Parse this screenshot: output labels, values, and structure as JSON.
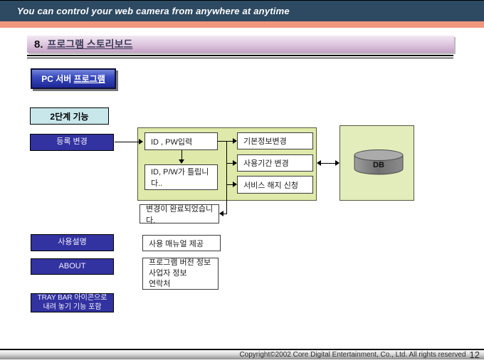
{
  "colors": {
    "top_bar_bg": "#2E4A62",
    "accent_salmon": "#F0977E",
    "title_gradient_top": "#F2E8F2",
    "title_gradient_bottom": "#C3A2C5",
    "indigo_box": "#3232A0",
    "cyan_box": "#C8E7EB",
    "flow_container_bg": "#DFE9A9",
    "db_container_bg": "#E3EDBC",
    "pc_button_blue": "#3A4CC0"
  },
  "header": {
    "tagline": "You can control your web camera  from anywhere at anytime",
    "title_number": "8.",
    "title_text": "프로그램 스토리보드"
  },
  "pc_server_button": {
    "label_prefix": "PC 서버 ",
    "label_underlined": "프로그램"
  },
  "left_column": {
    "stage_label": "2단계 기능",
    "register_change": "등록 변경",
    "usage_guide": "사용설명",
    "about": "ABOUT",
    "tray_bar_line1": "TRAY BAR 아이콘으로",
    "tray_bar_line2": "내려 놓기 기능 포함"
  },
  "flow": {
    "id_pw_input": "ID , PW입력",
    "id_pw_wrong": "ID, P/W가 틀립니다..",
    "basic_info_change": "기본정보변경",
    "usage_period_change": "사용기간 변경",
    "service_cancel": "서비스 해지 신청",
    "change_complete": "변경이 완료되었습니다.",
    "db_label": "DB",
    "usage_manual": "사용 매뉴얼 제공",
    "about_info_line1": "프로그램 버전 정보",
    "about_info_line2": "사업자 정보",
    "about_info_line3": "연락처"
  },
  "footer": {
    "copyright": "Copyright©2002 Core Digital Entertainment, Co., Ltd. All rights reserved",
    "page_number": "12"
  }
}
